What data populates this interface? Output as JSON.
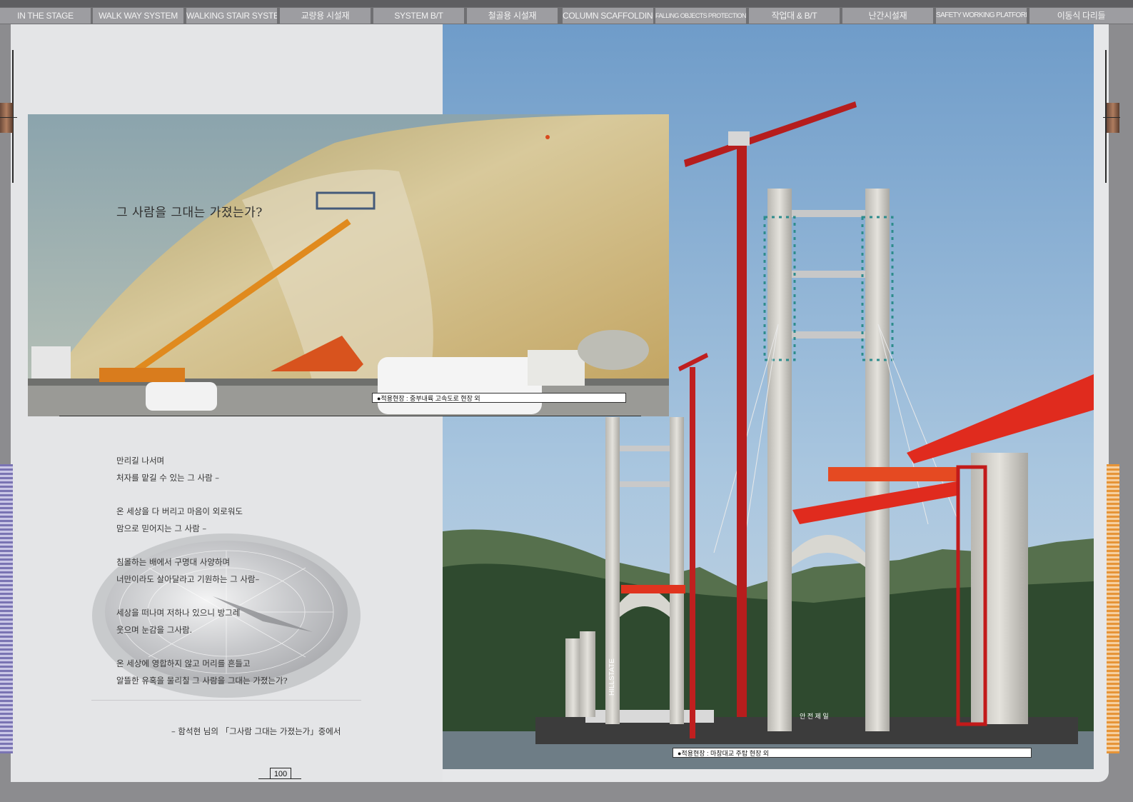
{
  "nav": {
    "tabs": [
      {
        "label": "IN THE STAGE"
      },
      {
        "label": "WALK WAY SYSTEM"
      },
      {
        "label": "WALKING STAIR SYSTEM"
      },
      {
        "label": "교량용 시설재"
      },
      {
        "label": "SYSTEM B/T"
      },
      {
        "label": "철골용 시설재"
      },
      {
        "label": "COLUMN SCAFFOLDING"
      },
      {
        "label": "FALLING OBJECTS PROTECTION PLATFORM"
      },
      {
        "label": "작업대 & B/T"
      },
      {
        "label": "난간시설재"
      },
      {
        "label": "SAFETY WORKING PLATFORM"
      },
      {
        "label": "이동식 다리들"
      }
    ]
  },
  "left_page": {
    "photo_title": "그 사람을 그대는 가졌는가?",
    "photo_caption": "●적용현장 : 중부내륙 고속도로 현장 외",
    "poem": {
      "stanzas": [
        [
          "만리길 나서며",
          "처자를 맡길 수 있는 그 사람 –"
        ],
        [
          "온 세상을 다 버리고 마음이 외로워도",
          "맘으로 믿어지는 그 사람 –"
        ],
        [
          "침몰하는 배에서 구명대 사양하며",
          "너만이라도 살아달라고 기원하는 그 사람–"
        ],
        [
          "세상을 떠나며 저하나 있으니 방그레",
          "웃으며 눈감을 그사람."
        ],
        [
          "온 세상에 영합하지 않고 머리를 흔들고",
          "알뜰한 유혹을 물리칠 그 사람을 그대는 가졌는가?"
        ]
      ]
    },
    "attribution": "– 함석현 님의 「그사람 그대는 가졌는가」중에서",
    "page_number": "100"
  },
  "right_page": {
    "photo_caption": "●적용현장 : 마창대교 주탑 현장 외",
    "tower_sign": "HILLSTATE",
    "deck_sign": "안 전 제 일"
  },
  "colors": {
    "nav_tab": "#9d9da1",
    "frame": "#e6e7e9",
    "stripe_left": "#7a74b3",
    "stripe_right": "#e69438"
  }
}
